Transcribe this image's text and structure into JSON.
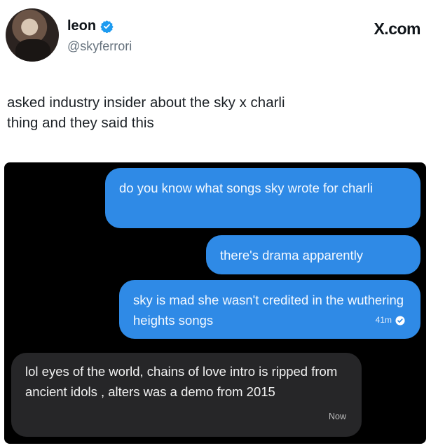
{
  "post": {
    "author_name": "leon",
    "author_handle": "@skyferrori",
    "brand": "X.com",
    "text_line1": "asked industry insider about the sky x charli",
    "text_line2": "thing and they said this"
  },
  "chat": {
    "messages": [
      {
        "direction": "outgoing",
        "text": "do you know what songs sky wrote for charli"
      },
      {
        "direction": "outgoing",
        "text": "there's drama apparently"
      },
      {
        "direction": "outgoing",
        "text": "sky is mad she wasn't credited in the wuthering heights songs",
        "time": "41m"
      },
      {
        "direction": "incoming",
        "text": "lol eyes of the world, chains of love intro is ripped from ancient idols , alters was a demo from 2015",
        "time": "Now"
      }
    ]
  },
  "colors": {
    "outgoing_bubble": "#2f8ae6",
    "incoming_bubble": "#262628",
    "chat_background": "#000000",
    "verified_badge": "#1d9bf0"
  },
  "icons": [
    "verified-badge-icon",
    "read-receipt-icon"
  ]
}
